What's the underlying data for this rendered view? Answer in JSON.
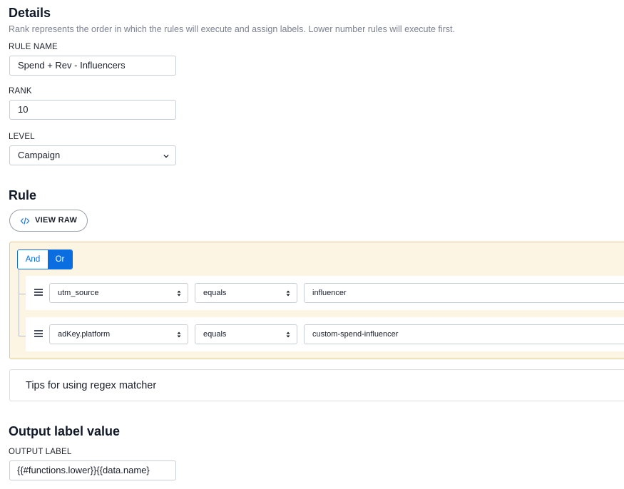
{
  "details": {
    "heading": "Details",
    "description": "Rank represents the order in which the rules will execute and assign labels. Lower number rules will execute first.",
    "rule_name_label": "RULE NAME",
    "rule_name_value": "Spend + Rev - Influencers",
    "rank_label": "RANK",
    "rank_value": "10",
    "level_label": "LEVEL",
    "level_value": "Campaign"
  },
  "rule": {
    "heading": "Rule",
    "view_raw_label": "VIEW RAW",
    "combinator": {
      "and_label": "And",
      "or_label": "Or",
      "selected": "Or"
    },
    "conditions": [
      {
        "field": "utm_source",
        "operator": "equals",
        "value": "influencer"
      },
      {
        "field": "adKey.platform",
        "operator": "equals",
        "value": "custom-spend-influencer"
      }
    ]
  },
  "tips": {
    "label": "Tips for using regex matcher"
  },
  "output": {
    "heading": "Output label value",
    "output_label_label": "OUTPUT LABEL",
    "output_label_value": "{{#functions.lower}}{{data.name}"
  },
  "colors": {
    "accent": "#0a6ee0",
    "rule_bg": "#fdf5e4",
    "rule_border": "#e6c98f"
  },
  "icons": [
    "code-icon",
    "chevron-down-icon",
    "drag-handle-icon",
    "updown-arrows-icon"
  ]
}
